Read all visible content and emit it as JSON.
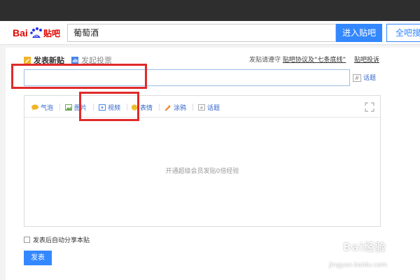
{
  "header": {
    "logo": "Bai贴吧",
    "search_value": "葡萄酒",
    "enter_button": "进入贴吧",
    "all_search_button": "全吧搜索"
  },
  "post_tabs": {
    "new_post": "发表新贴",
    "start_vote": "发起投票"
  },
  "notice": {
    "prefix": "发贴请遵守",
    "agreement_link": "贴吧协议及“七条底线”",
    "complaint_link": "贴吧投诉"
  },
  "title_input": {
    "value": "",
    "topic_label": "话题",
    "hash_symbol": "#"
  },
  "toolbar": [
    {
      "label": "气泡",
      "icon": "bubble-icon",
      "color": "#f0b429"
    },
    {
      "label": "图片",
      "icon": "image-icon",
      "color": "#6aa84f"
    },
    {
      "label": "视频",
      "icon": "video-icon",
      "color": "#4a86e8"
    },
    {
      "label": "表情",
      "icon": "emoji-icon",
      "color": "#f1c232"
    },
    {
      "label": "涂鸦",
      "icon": "doodle-icon",
      "color": "#e69138"
    },
    {
      "label": "话题",
      "icon": "topic-icon",
      "color": "#999999"
    }
  ],
  "editor": {
    "placeholder": "开通超级会员发贴0倍经验"
  },
  "share_option": {
    "label": "发表后自动分享本贴",
    "checked": false
  },
  "submit_button": "发表",
  "watermark": {
    "text": "Bai经验",
    "sub": "jingyan.baidu.com"
  },
  "colors": {
    "accent": "#3388ff",
    "highlight": "#e02a2a",
    "link": "#3366cc"
  }
}
